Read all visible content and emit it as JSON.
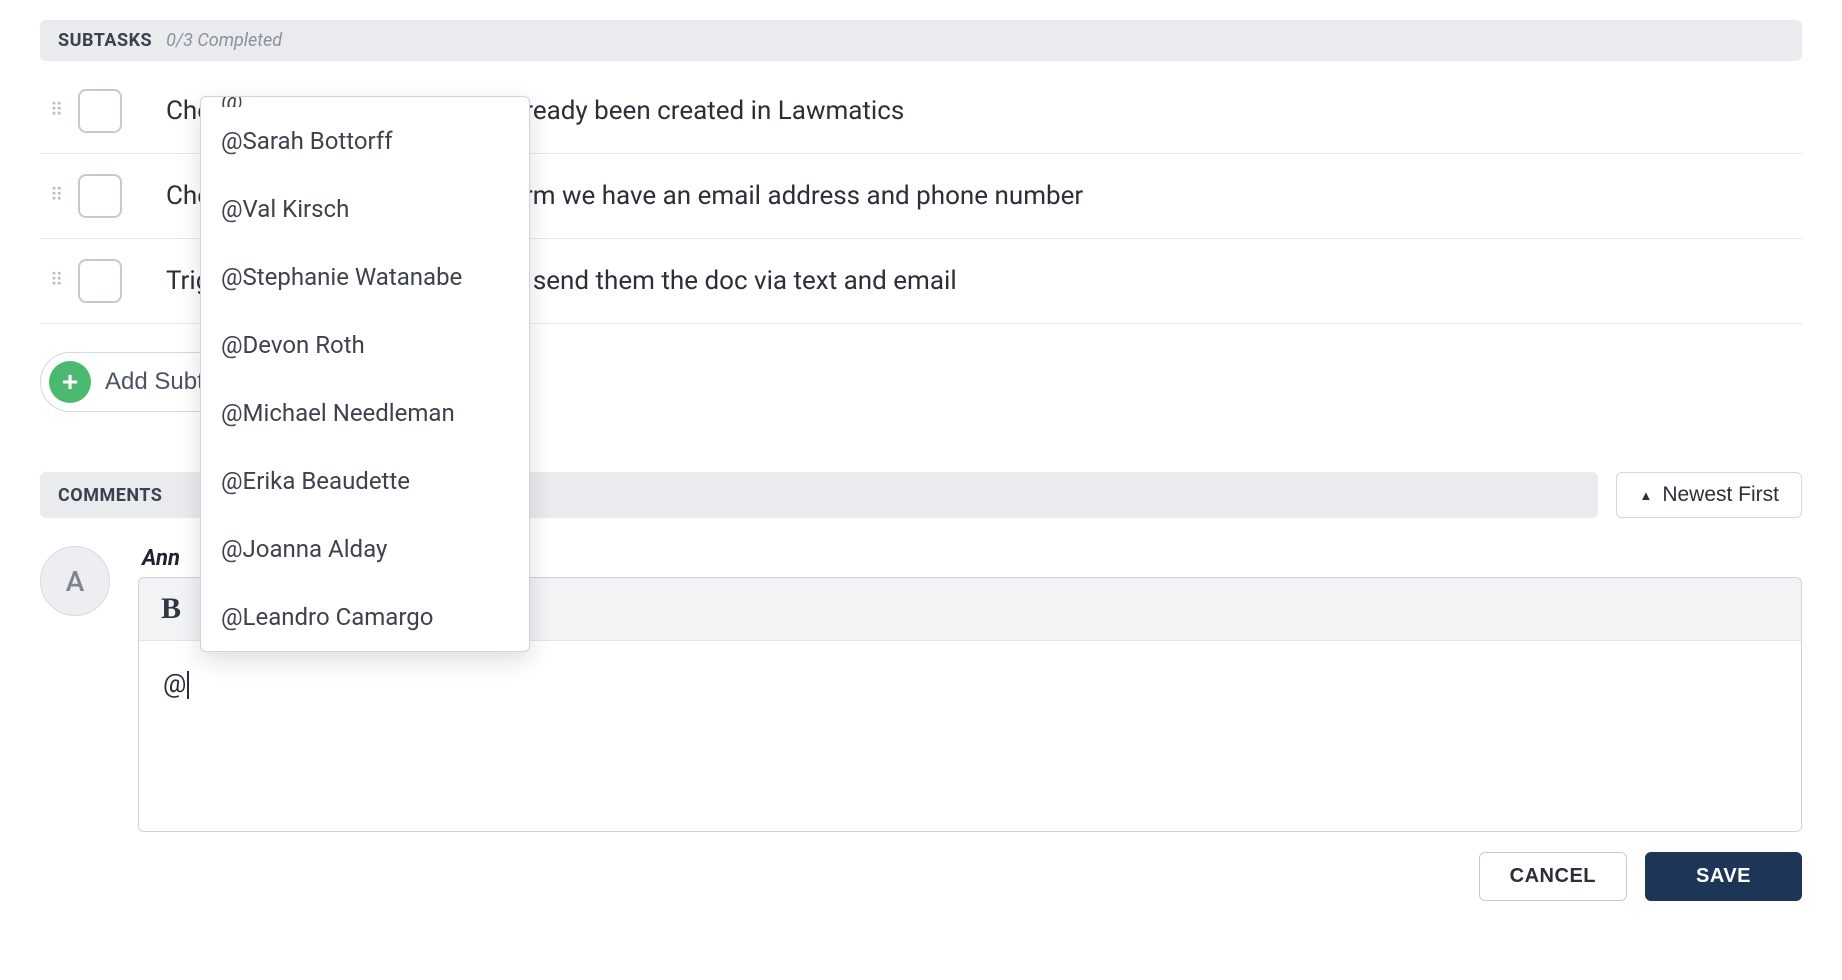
{
  "subtasks_section": {
    "title": "SUBTASKS",
    "meta": "0/3 Completed",
    "items": [
      {
        "text_full": "Check to see if the client has already been created in Lawmatics",
        "text_prefix": "Ch",
        "text_suffix": "ted in Lawmatics"
      },
      {
        "text_full": "Check the client record to confirm we have an email address and phone number",
        "text_prefix": "Ch",
        "text_suffix": "email address and phone number"
      },
      {
        "text_full": "Trigger the automation that will send them the doc via text and email",
        "text_prefix": "Tri",
        "text_suffix": "he doc via text and email"
      }
    ],
    "add_label": "Add Su",
    "add_label_full": "Add Subtask"
  },
  "mention_popup": {
    "header_fragment": "@",
    "people": [
      "@Sarah Bottorff",
      "@Val Kirsch",
      "@Stephanie Watanabe",
      "@Devon Roth",
      "@Michael Needleman",
      "@Erika Beaudette",
      "@Joanna Alday",
      "@Leandro Camargo"
    ]
  },
  "comments_section": {
    "title": "COMMENTS",
    "sort_label": "Newest First",
    "author_initial": "A",
    "author_name_visible": "Ann",
    "toolbar": {
      "bold": "B"
    },
    "body_text": "@",
    "cancel_label": "CANCEL",
    "save_label": "SAVE"
  }
}
